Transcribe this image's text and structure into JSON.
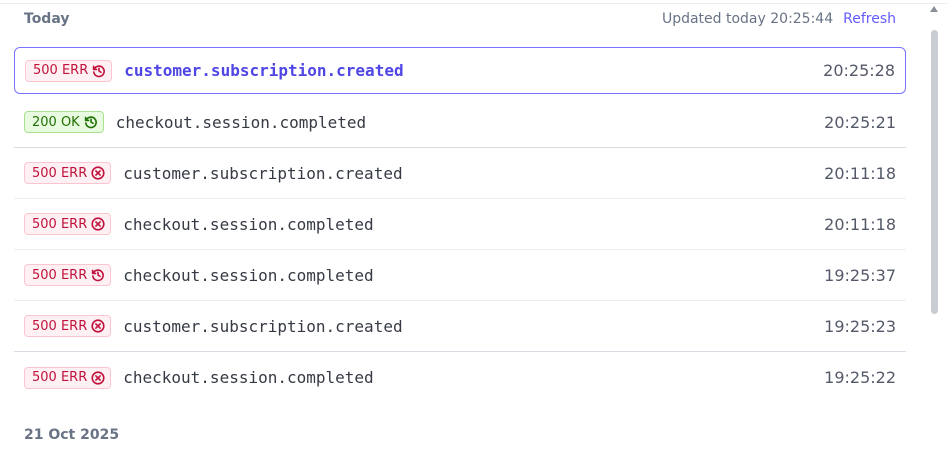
{
  "header": {
    "section_title": "Today",
    "updated_text": "Updated today 20:25:44",
    "refresh_label": "Refresh"
  },
  "events": [
    {
      "status": "500 ERR",
      "kind": "err",
      "icon": "history-icon",
      "name": "customer.subscription.created",
      "time": "20:25:28",
      "selected": true
    },
    {
      "status": "200 OK",
      "kind": "ok",
      "icon": "history-icon",
      "name": "checkout.session.completed",
      "time": "20:25:21"
    },
    {
      "status": "500 ERR",
      "kind": "err",
      "icon": "x-circle-icon",
      "name": "customer.subscription.created",
      "time": "20:11:18"
    },
    {
      "status": "500 ERR",
      "kind": "err",
      "icon": "x-circle-icon",
      "name": "checkout.session.completed",
      "time": "20:11:18"
    },
    {
      "status": "500 ERR",
      "kind": "err",
      "icon": "history-icon",
      "name": "checkout.session.completed",
      "time": "19:25:37"
    },
    {
      "status": "500 ERR",
      "kind": "err",
      "icon": "x-circle-icon",
      "name": "customer.subscription.created",
      "time": "19:25:23"
    },
    {
      "status": "500 ERR",
      "kind": "err",
      "icon": "x-circle-icon",
      "name": "checkout.session.completed",
      "time": "19:25:22"
    }
  ],
  "next_section": {
    "title": "21 Oct 2025"
  },
  "colors": {
    "accent": "#635bff",
    "error": "#c0123c",
    "success": "#217005"
  }
}
